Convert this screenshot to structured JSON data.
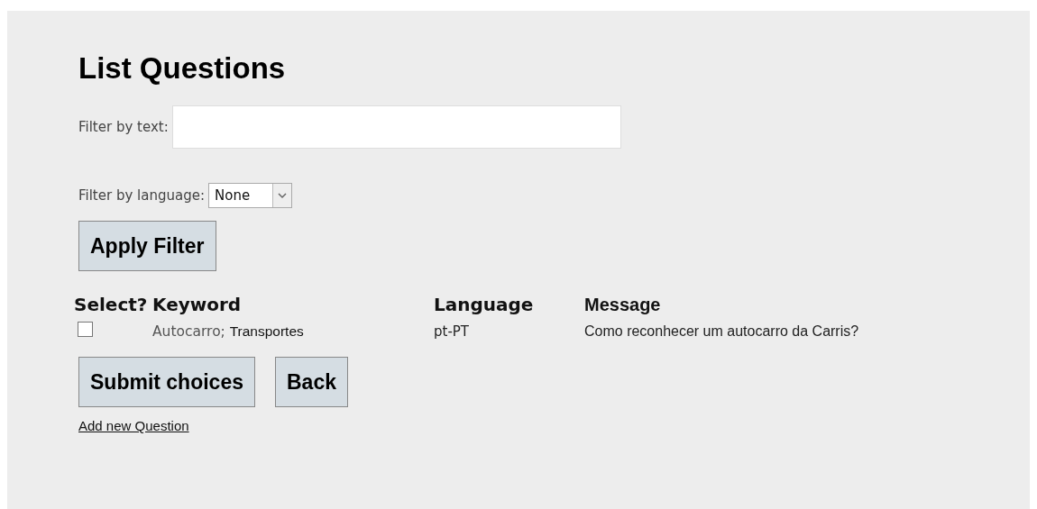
{
  "title": "List Questions",
  "filter_text": {
    "label": "Filter by text:"
  },
  "filter_language": {
    "label": "Filter by language:",
    "value": "None"
  },
  "apply_button": "Apply Filter",
  "table": {
    "columns": [
      "Select?",
      "Keyword",
      "Language",
      "Message"
    ],
    "rows": [
      {
        "checked": false,
        "keywords": [
          {
            "text": "Autocarro;",
            "color": "#555555"
          },
          {
            "text": "Transportes",
            "color": "#111111"
          }
        ],
        "language": "pt-PT",
        "message": "Como reconhecer um autocarro da Carris?"
      }
    ]
  },
  "buttons": [
    "Submit choices",
    "Back"
  ],
  "link": "Add new Question"
}
